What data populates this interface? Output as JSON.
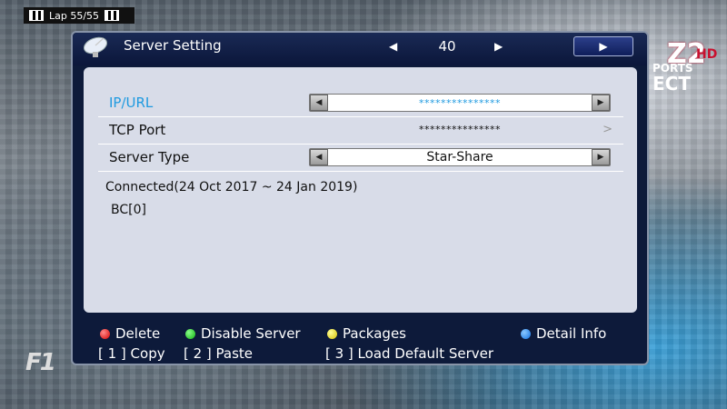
{
  "overlay": {
    "lap_text": "Lap 55/55"
  },
  "dialog": {
    "title": "Server Setting",
    "nav_left": "◀",
    "nav_right": "▶",
    "slot_number": "40",
    "play_button": "▶",
    "rows": [
      {
        "label": "IP/URL",
        "value": "***************",
        "type": "selector",
        "active": true
      },
      {
        "label": "TCP Port",
        "value": "***************",
        "type": "text",
        "chevron": ">"
      },
      {
        "label": "Server Type",
        "value": "Star-Share",
        "type": "selector"
      }
    ],
    "arrow_left": "◀",
    "arrow_right": "▶",
    "status": "Connected(24 Oct 2017 ~ 24 Jan 2019)",
    "bc": "BC[0]",
    "footer": {
      "red_label": "Delete",
      "green_label": "Disable Server",
      "yellow_label": "Packages",
      "blue_label": "Detail Info",
      "copy_label": "[ 1 ] Copy",
      "paste_label": "[ 2 ] Paste",
      "load_label": "[ 3 ] Load Default Server"
    }
  },
  "colors": {
    "active_label": "#1f9ae0",
    "dialog_bg": "#0d1a3a",
    "panel_bg": "#d8dce8"
  }
}
